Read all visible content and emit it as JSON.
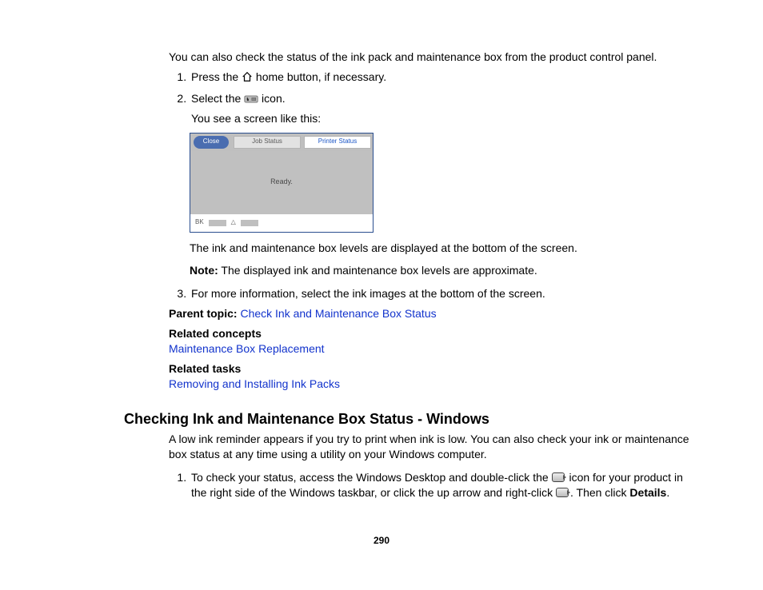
{
  "intro": "You can also check the status of the ink pack and maintenance box from the product control panel.",
  "step1": {
    "pre": "Press the ",
    "post": " home button, if necessary."
  },
  "step2": {
    "line1_pre": "Select the ",
    "line1_post": " icon.",
    "line2": "You see a screen like this:"
  },
  "screenshot": {
    "close": "Close",
    "tab_job": "Job Status",
    "tab_printer": "Printer Status",
    "body_text": "Ready.",
    "foot_bk": "BK",
    "foot_tri": "△"
  },
  "after_screen_para": "The ink and maintenance box levels are displayed at the bottom of the screen.",
  "note_label": "Note:",
  "note_text": " The displayed ink and maintenance box levels are approximate.",
  "step3": "For more information, select the ink images at the bottom of the screen.",
  "parent_topic_label": "Parent topic:",
  "parent_topic_link": "Check Ink and Maintenance Box Status",
  "related_concepts_label": "Related concepts",
  "related_concepts_link": "Maintenance Box Replacement",
  "related_tasks_label": "Related tasks",
  "related_tasks_link": "Removing and Installing Ink Packs",
  "heading2": "Checking Ink and Maintenance Box Status - Windows",
  "section_para": "A low ink reminder appears if you try to print when ink is low. You can also check your ink or maintenance box status at any time using a utility on your Windows computer.",
  "win_step1": {
    "a": "To check your status, access the Windows Desktop and double-click the ",
    "b": " icon for your product in the right side of the Windows taskbar, or click the up arrow and right-click ",
    "c": ". Then click ",
    "details": "Details",
    "d": "."
  },
  "page_number": "290"
}
